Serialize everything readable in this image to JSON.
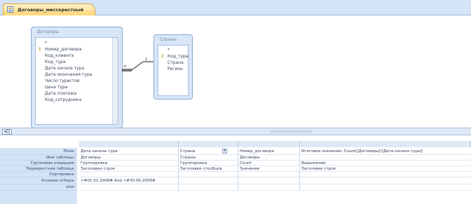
{
  "tab": {
    "title": "Договоры_миссерестный"
  },
  "tables": [
    {
      "title": "Договоры",
      "fields": [
        "*",
        "Номер_договора",
        "Код_клиента",
        "Код_тура",
        "Дата начала тура",
        "Дата окончания тура",
        "Число туристов",
        "Цена тура",
        "Дата платежа",
        "Код_сотрудника"
      ],
      "key_field": "Номер_договора"
    },
    {
      "title": "Страны",
      "fields": [
        "*",
        "Код_тура",
        "Страна",
        "Регион"
      ],
      "key_field": "Код_тура"
    }
  ],
  "relation": {
    "one_label": "1",
    "many_label": "∞"
  },
  "scroll": {
    "left_label": "◂|||"
  },
  "grid": {
    "row_labels": [
      "Поле:",
      "Имя таблицы:",
      "Групповая операция:",
      "Перекрестная таблица:",
      "Сортировка:",
      "Условие отбора:",
      "или:"
    ],
    "columns": [
      {
        "field": "Дата начала тура",
        "table": "Договоры",
        "group": "Группировка",
        "crosstab": "Заголовки строк",
        "sort": "",
        "criteria": ">#01.01.2009# And <#30.06.2009#",
        "or": ""
      },
      {
        "field": "Страна",
        "table": "Страны",
        "group": "Группировка",
        "crosstab": "Заголовки столбцов",
        "sort": "",
        "criteria": "",
        "or": ""
      },
      {
        "field": "Номер_договора",
        "table": "Договоры",
        "group": "Count",
        "crosstab": "Значение",
        "sort": "",
        "criteria": "",
        "or": ""
      },
      {
        "field": "Итоговое значение: Count([Договоры]![Дата начала тура])",
        "table": "",
        "group": "Выражение",
        "crosstab": "Заголовки строк",
        "sort": "",
        "criteria": "",
        "or": ""
      }
    ]
  }
}
